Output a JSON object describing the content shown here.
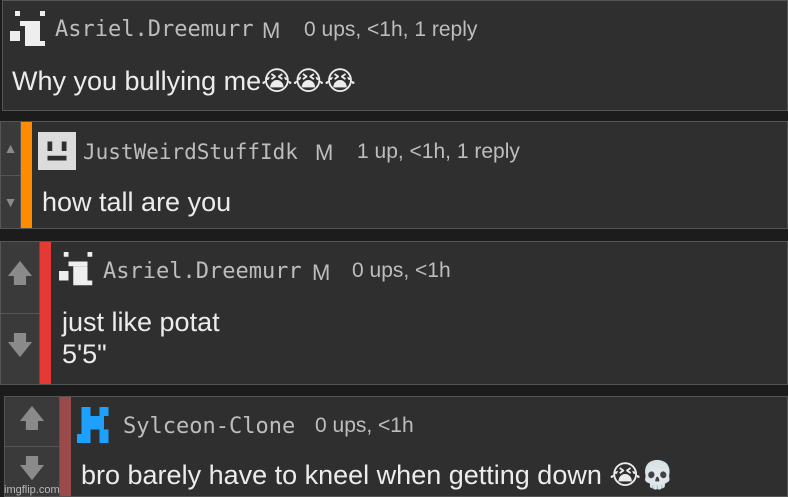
{
  "comments": [
    {
      "username": "Asriel.Dreemurr",
      "gender": "M",
      "meta": "0 ups, <1h, 1 reply",
      "text": "Why you bullying me😭😭😭",
      "avatar_icon": "goat-face-avatar-icon"
    },
    {
      "username": "JustWeirdStuffIdk",
      "gender": "M",
      "meta": "1 up, <1h, 1 reply",
      "text": "how tall are you",
      "stripe_color": "#ff8c00",
      "avatar_icon": "square-face-avatar-icon"
    },
    {
      "username": "Asriel.Dreemurr",
      "gender": "M",
      "meta": "0 ups, <1h",
      "text": "just like potat\n5'5\"",
      "stripe_color": "#e53935",
      "avatar_icon": "goat-face-avatar-icon"
    },
    {
      "username": "Sylceon-Clone",
      "gender": "",
      "meta": "0 ups, <1h",
      "text": "bro barely have to kneel when getting down 😭💀",
      "stripe_color": "#a04040",
      "avatar_icon": "blue-pixel-avatar-icon"
    }
  ],
  "watermark": "imgflip.com"
}
